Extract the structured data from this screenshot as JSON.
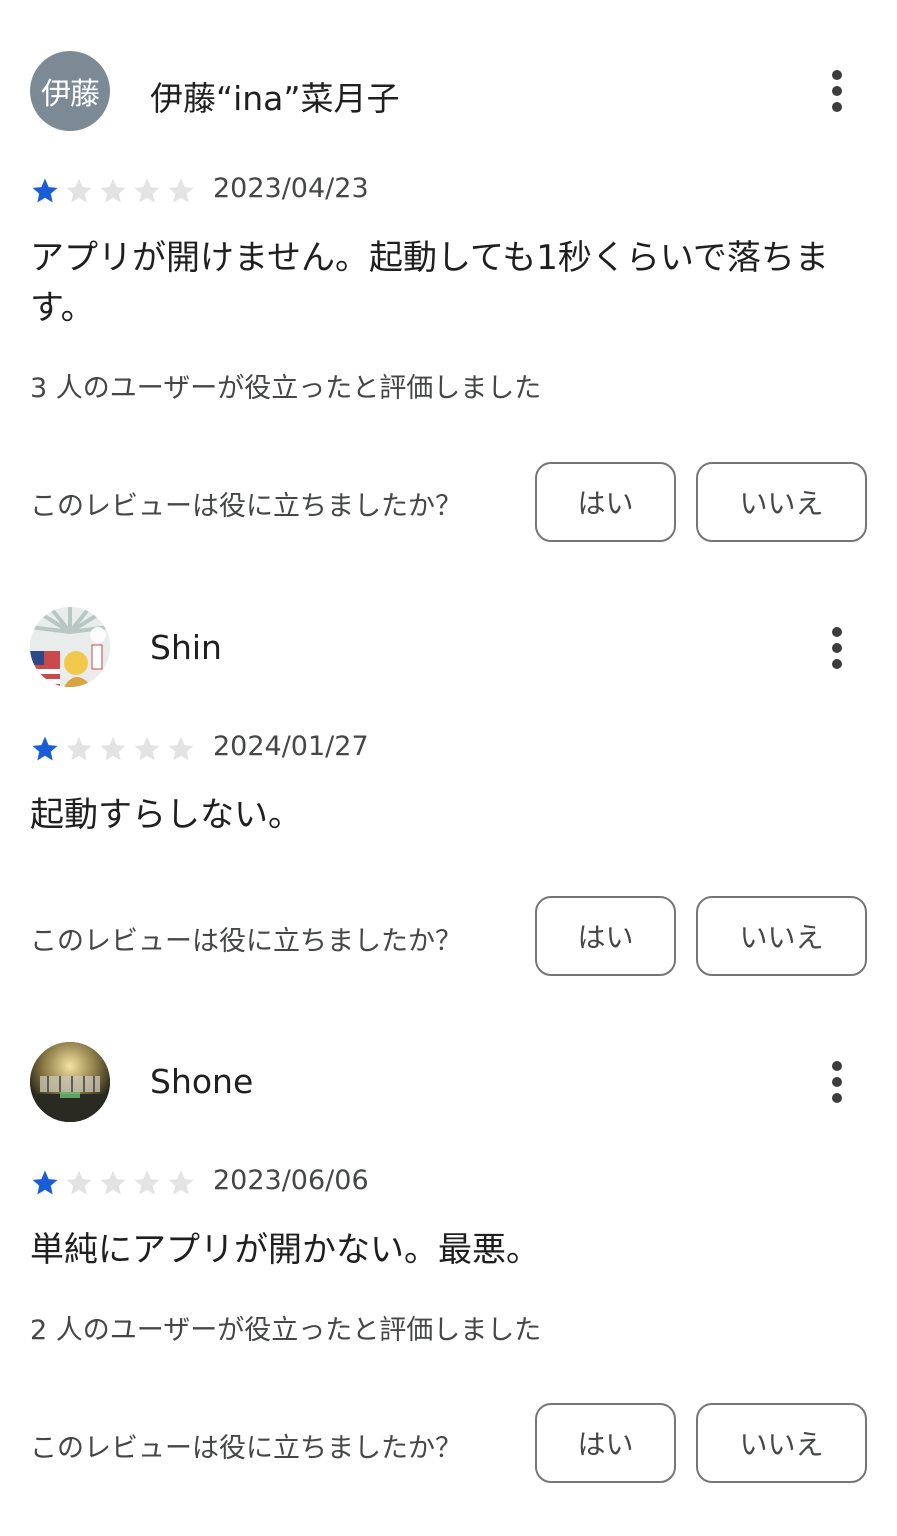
{
  "accent_star_color": "#1a5dd8",
  "empty_star_color": "#e3e3e3",
  "question": "このレビューは役に立ちましたか？",
  "yes_label": "はい",
  "no_label": "いいえ",
  "reviews": [
    {
      "author": "伊藤“ina”菜月子",
      "avatar_text": "伊藤",
      "avatar_color": "#7b8a95",
      "rating": 1,
      "max_rating": 5,
      "date": "2023/04/23",
      "text": "アプリが開けません。起動しても1秒くらいで落ちます。",
      "helpful": "3 人のユーザーが役立ったと評価しました"
    },
    {
      "author": "Shin",
      "avatar_icon": "illustration-avatar-icon",
      "rating": 1,
      "max_rating": 5,
      "date": "2024/01/27",
      "text": "起動すらしない。",
      "helpful": ""
    },
    {
      "author": "Shone",
      "avatar_icon": "concert-photo-avatar-icon",
      "rating": 1,
      "max_rating": 5,
      "date": "2023/06/06",
      "text": "単純にアプリが開かない。最悪。",
      "helpful": "2 人のユーザーが役立ったと評価しました"
    }
  ]
}
